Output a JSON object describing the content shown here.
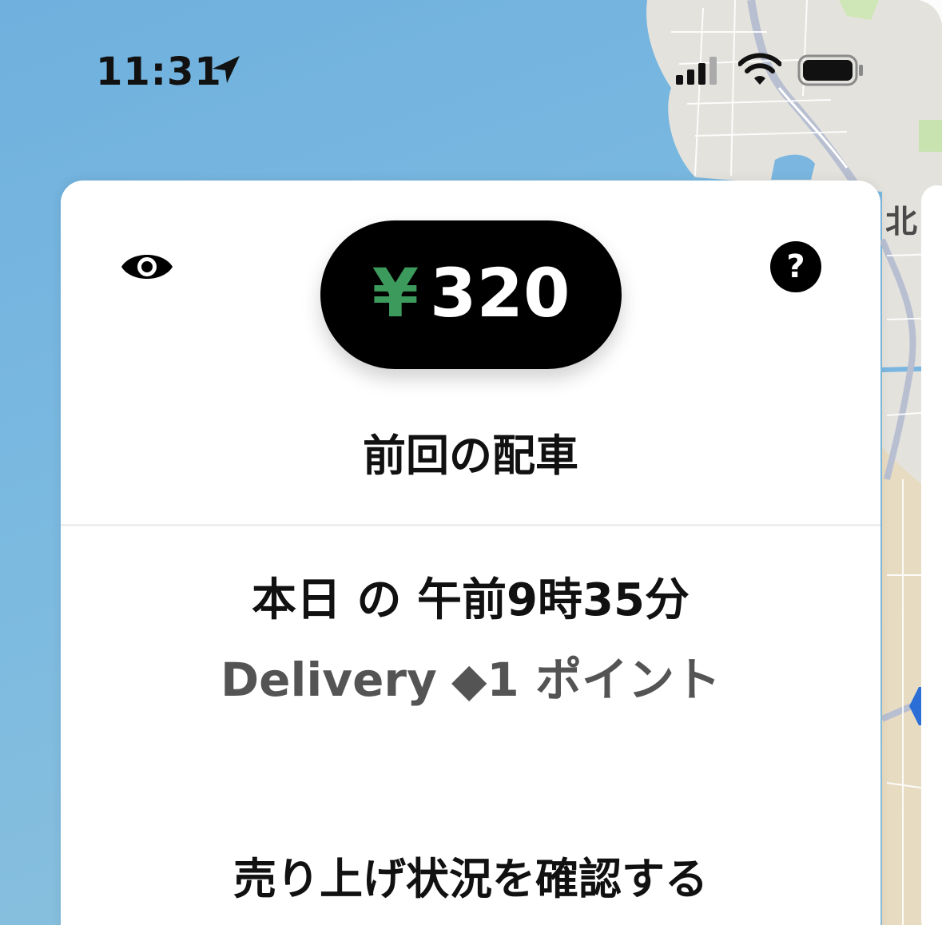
{
  "status_bar": {
    "time": "11:31",
    "location_icon": "location-arrow-icon",
    "signal_icon": "cellular-signal-icon",
    "wifi_icon": "wifi-icon",
    "battery_icon": "battery-icon"
  },
  "map": {
    "label": "北"
  },
  "card": {
    "eye_icon": "eye-icon",
    "help_icon": "question-mark-icon",
    "help_glyph": "?",
    "earnings": {
      "currency_symbol": "¥",
      "amount": "320",
      "currency_color": "#3d9a5d"
    },
    "section_title": "前回の配車",
    "last_trip": {
      "time_text": "本日 の 午前9時35分",
      "service_type": "Delivery",
      "points_text": "◆1 ポイント"
    },
    "check_earnings_label": "売り上げ状況を確認する"
  }
}
